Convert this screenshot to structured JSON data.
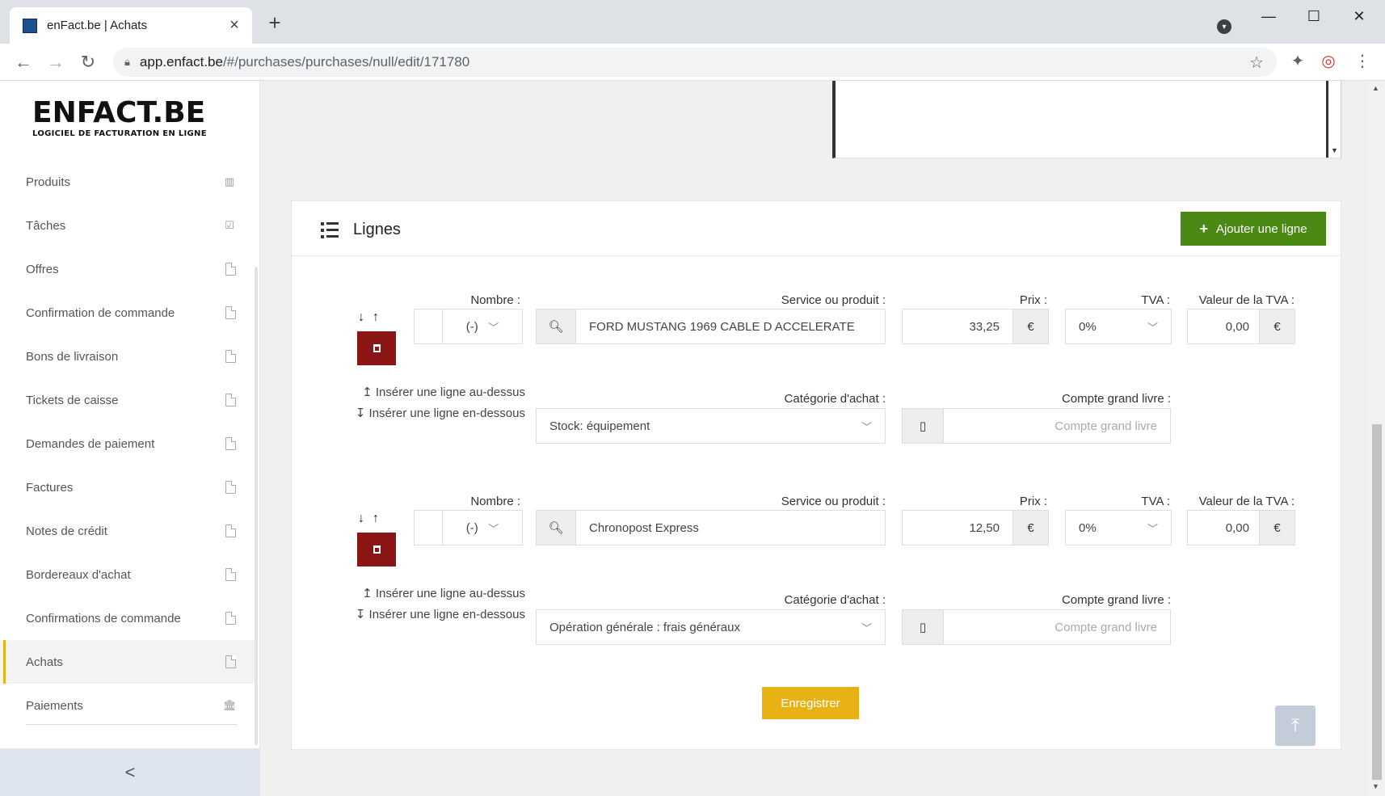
{
  "browser": {
    "tab_title": "enFact.be | Achats",
    "url_host": "app.enfact.be",
    "url_path": "/#/purchases/purchases/null/edit/171780"
  },
  "sidebar": {
    "logo_main": "ENFACT.BE",
    "logo_sub": "LOGICIEL DE FACTURATION EN LIGNE",
    "items": [
      {
        "label": "Produits",
        "icon": "barcode-icon"
      },
      {
        "label": "Tâches",
        "icon": "clipboard-check-icon"
      },
      {
        "label": "Offres",
        "icon": "pdf-icon"
      },
      {
        "label": "Confirmation de commande",
        "icon": "pdf-icon"
      },
      {
        "label": "Bons de livraison",
        "icon": "pdf-icon"
      },
      {
        "label": "Tickets de caisse",
        "icon": "pdf-icon"
      },
      {
        "label": "Demandes de paiement",
        "icon": "pdf-icon"
      },
      {
        "label": "Factures",
        "icon": "pdf-icon"
      },
      {
        "label": "Notes de crédit",
        "icon": "pdf-icon"
      },
      {
        "label": "Bordereaux d'achat",
        "icon": "pdf-icon"
      },
      {
        "label": "Confirmations de commande",
        "icon": "pdf-icon"
      },
      {
        "label": "Achats",
        "icon": "pdf-icon",
        "active": true
      },
      {
        "label": "Paiements",
        "icon": "bank-icon"
      }
    ],
    "collapse_symbol": "<"
  },
  "card": {
    "title": "Lignes",
    "add_button": "Ajouter une ligne",
    "save_button": "Enregistrer"
  },
  "labels": {
    "nombre": "Nombre :",
    "service": "Service ou produit :",
    "prix": "Prix :",
    "tva": "TVA :",
    "valeur_tva": "Valeur de la TVA :",
    "categorie": "Catégorie d'achat :",
    "compte": "Compte grand livre :",
    "insert_above": "Insérer une ligne au-dessus",
    "insert_below": "Insérer une ligne en-dessous",
    "compte_placeholder": "Compte grand livre",
    "currency": "€"
  },
  "lines": [
    {
      "nombre": "(-)",
      "service": "FORD MUSTANG 1969 CABLE D ACCELERATE",
      "prix": "33,25",
      "tva": "0%",
      "valeur_tva": "0,00",
      "categorie": "Stock: équipement"
    },
    {
      "nombre": "(-)",
      "service": "Chronopost Express",
      "prix": "12,50",
      "tva": "0%",
      "valeur_tva": "0,00",
      "categorie": "Opération générale : frais généraux"
    }
  ]
}
